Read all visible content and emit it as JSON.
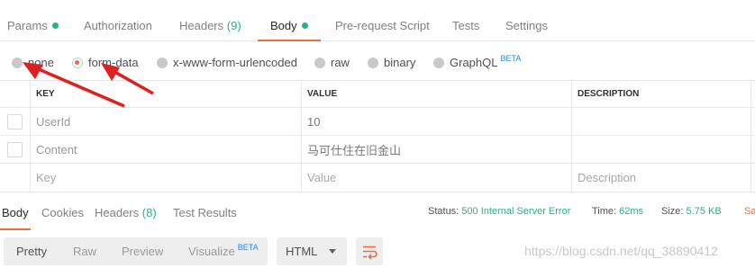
{
  "request_tabs": [
    {
      "label": "Params",
      "dot": true
    },
    {
      "label": "Authorization"
    },
    {
      "label": "Headers",
      "count": "(9)"
    },
    {
      "label": "Body",
      "dot": true,
      "active": true
    },
    {
      "label": "Pre-request Script"
    },
    {
      "label": "Tests"
    },
    {
      "label": "Settings"
    }
  ],
  "body_modes": [
    {
      "label": "none"
    },
    {
      "label": "form-data",
      "selected": true
    },
    {
      "label": "x-www-form-urlencoded"
    },
    {
      "label": "raw"
    },
    {
      "label": "binary"
    },
    {
      "label": "GraphQL",
      "badge": "BETA"
    }
  ],
  "table": {
    "headers": [
      "KEY",
      "VALUE",
      "DESCRIPTION"
    ],
    "rows": [
      {
        "key": "UserId",
        "value": "10",
        "description": ""
      },
      {
        "key": "Content",
        "value": "马可仕住在旧金山",
        "description": ""
      }
    ],
    "placeholder": {
      "key": "Key",
      "value": "Value",
      "description": "Description"
    }
  },
  "response_tabs": [
    {
      "label": "Body",
      "active": true
    },
    {
      "label": "Cookies"
    },
    {
      "label": "Headers",
      "count": "(8)"
    },
    {
      "label": "Test Results"
    }
  ],
  "response_status": {
    "status_label": "Status:",
    "status_value": "500 Internal Server Error",
    "time_label": "Time:",
    "time_value": "62ms",
    "size_label": "Size:",
    "size_value": "5.75 KB",
    "save_label": "Sa"
  },
  "view_modes": [
    {
      "label": "Pretty",
      "active": true
    },
    {
      "label": "Raw"
    },
    {
      "label": "Preview"
    },
    {
      "label": "Visualize",
      "badge": "BETA"
    }
  ],
  "format_select": {
    "value": "HTML"
  },
  "watermark": "https://blog.csdn.net/qq_38890412",
  "colors": {
    "accent": "#f26b3a",
    "success": "#26b47f",
    "arrow": "#e02020",
    "beta": "#1e88e5"
  },
  "icons": {
    "wrap": "wrap-lines-icon",
    "caret": "chevron-down-icon"
  }
}
